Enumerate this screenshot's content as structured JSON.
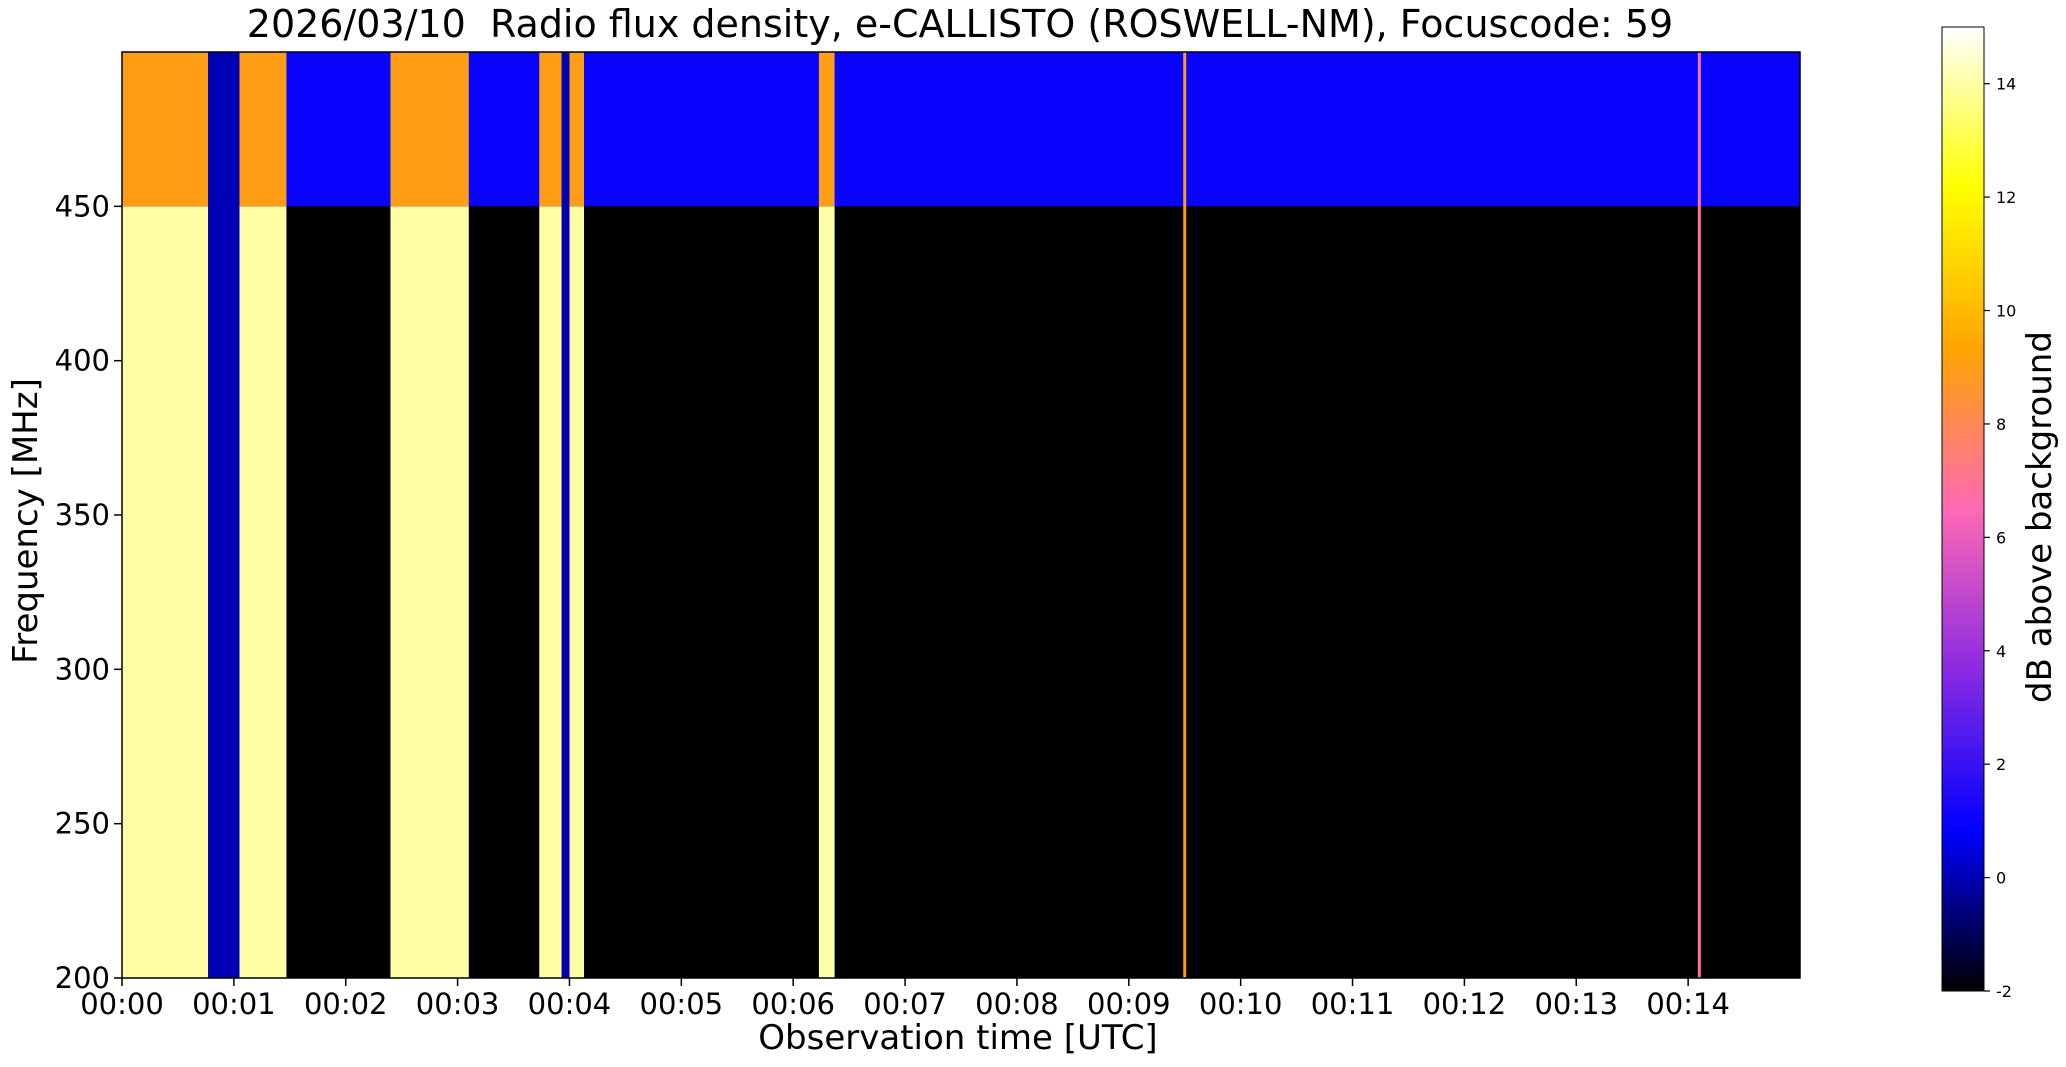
{
  "chart_data": {
    "type": "heatmap",
    "title": "2026/03/10  Radio flux density, e-CALLISTO (ROSWELL-NM), Focuscode: 59",
    "xlabel": "Observation time [UTC]",
    "ylabel": "Frequency [MHz]",
    "colorbar_label": "dB above background",
    "x_range_minutes": [
      0,
      15
    ],
    "ylim": [
      200,
      500
    ],
    "x_ticks": [
      "00:00",
      "00:01",
      "00:02",
      "00:03",
      "00:04",
      "00:05",
      "00:06",
      "00:07",
      "00:08",
      "00:09",
      "00:10",
      "00:11",
      "00:12",
      "00:13",
      "00:14"
    ],
    "y_ticks": [
      200,
      250,
      300,
      350,
      400,
      450
    ],
    "colorbar_range": [
      -2,
      15
    ],
    "colorbar_ticks": [
      -2,
      0,
      2,
      4,
      6,
      8,
      10,
      12,
      14
    ],
    "colormap": [
      "#000000",
      "#0000ff",
      "#8a2be2",
      "#ff69b4",
      "#ffa500",
      "#ffff00",
      "#ffffff"
    ],
    "background_band": {
      "freq_range": [
        450,
        500
      ],
      "db": 1
    },
    "high_flux_bands": [
      {
        "t_start": 0.0,
        "t_end": 0.77,
        "db": 14
      },
      {
        "t_start": 1.05,
        "t_end": 1.47,
        "db": 14
      },
      {
        "t_start": 2.4,
        "t_end": 3.1,
        "db": 14
      },
      {
        "t_start": 3.73,
        "t_end": 3.93,
        "db": 14
      },
      {
        "t_start": 4.0,
        "t_end": 4.13,
        "db": 14
      },
      {
        "t_start": 6.23,
        "t_end": 6.37,
        "db": 14
      }
    ],
    "dark_gaps": [
      {
        "t_start": 0.77,
        "t_end": 1.05,
        "db": 0
      },
      {
        "t_start": 3.93,
        "t_end": 4.0,
        "db": 0
      }
    ],
    "spike_lines": [
      {
        "t": 9.5,
        "db": 9
      },
      {
        "t": 14.1,
        "db": 7
      }
    ]
  }
}
